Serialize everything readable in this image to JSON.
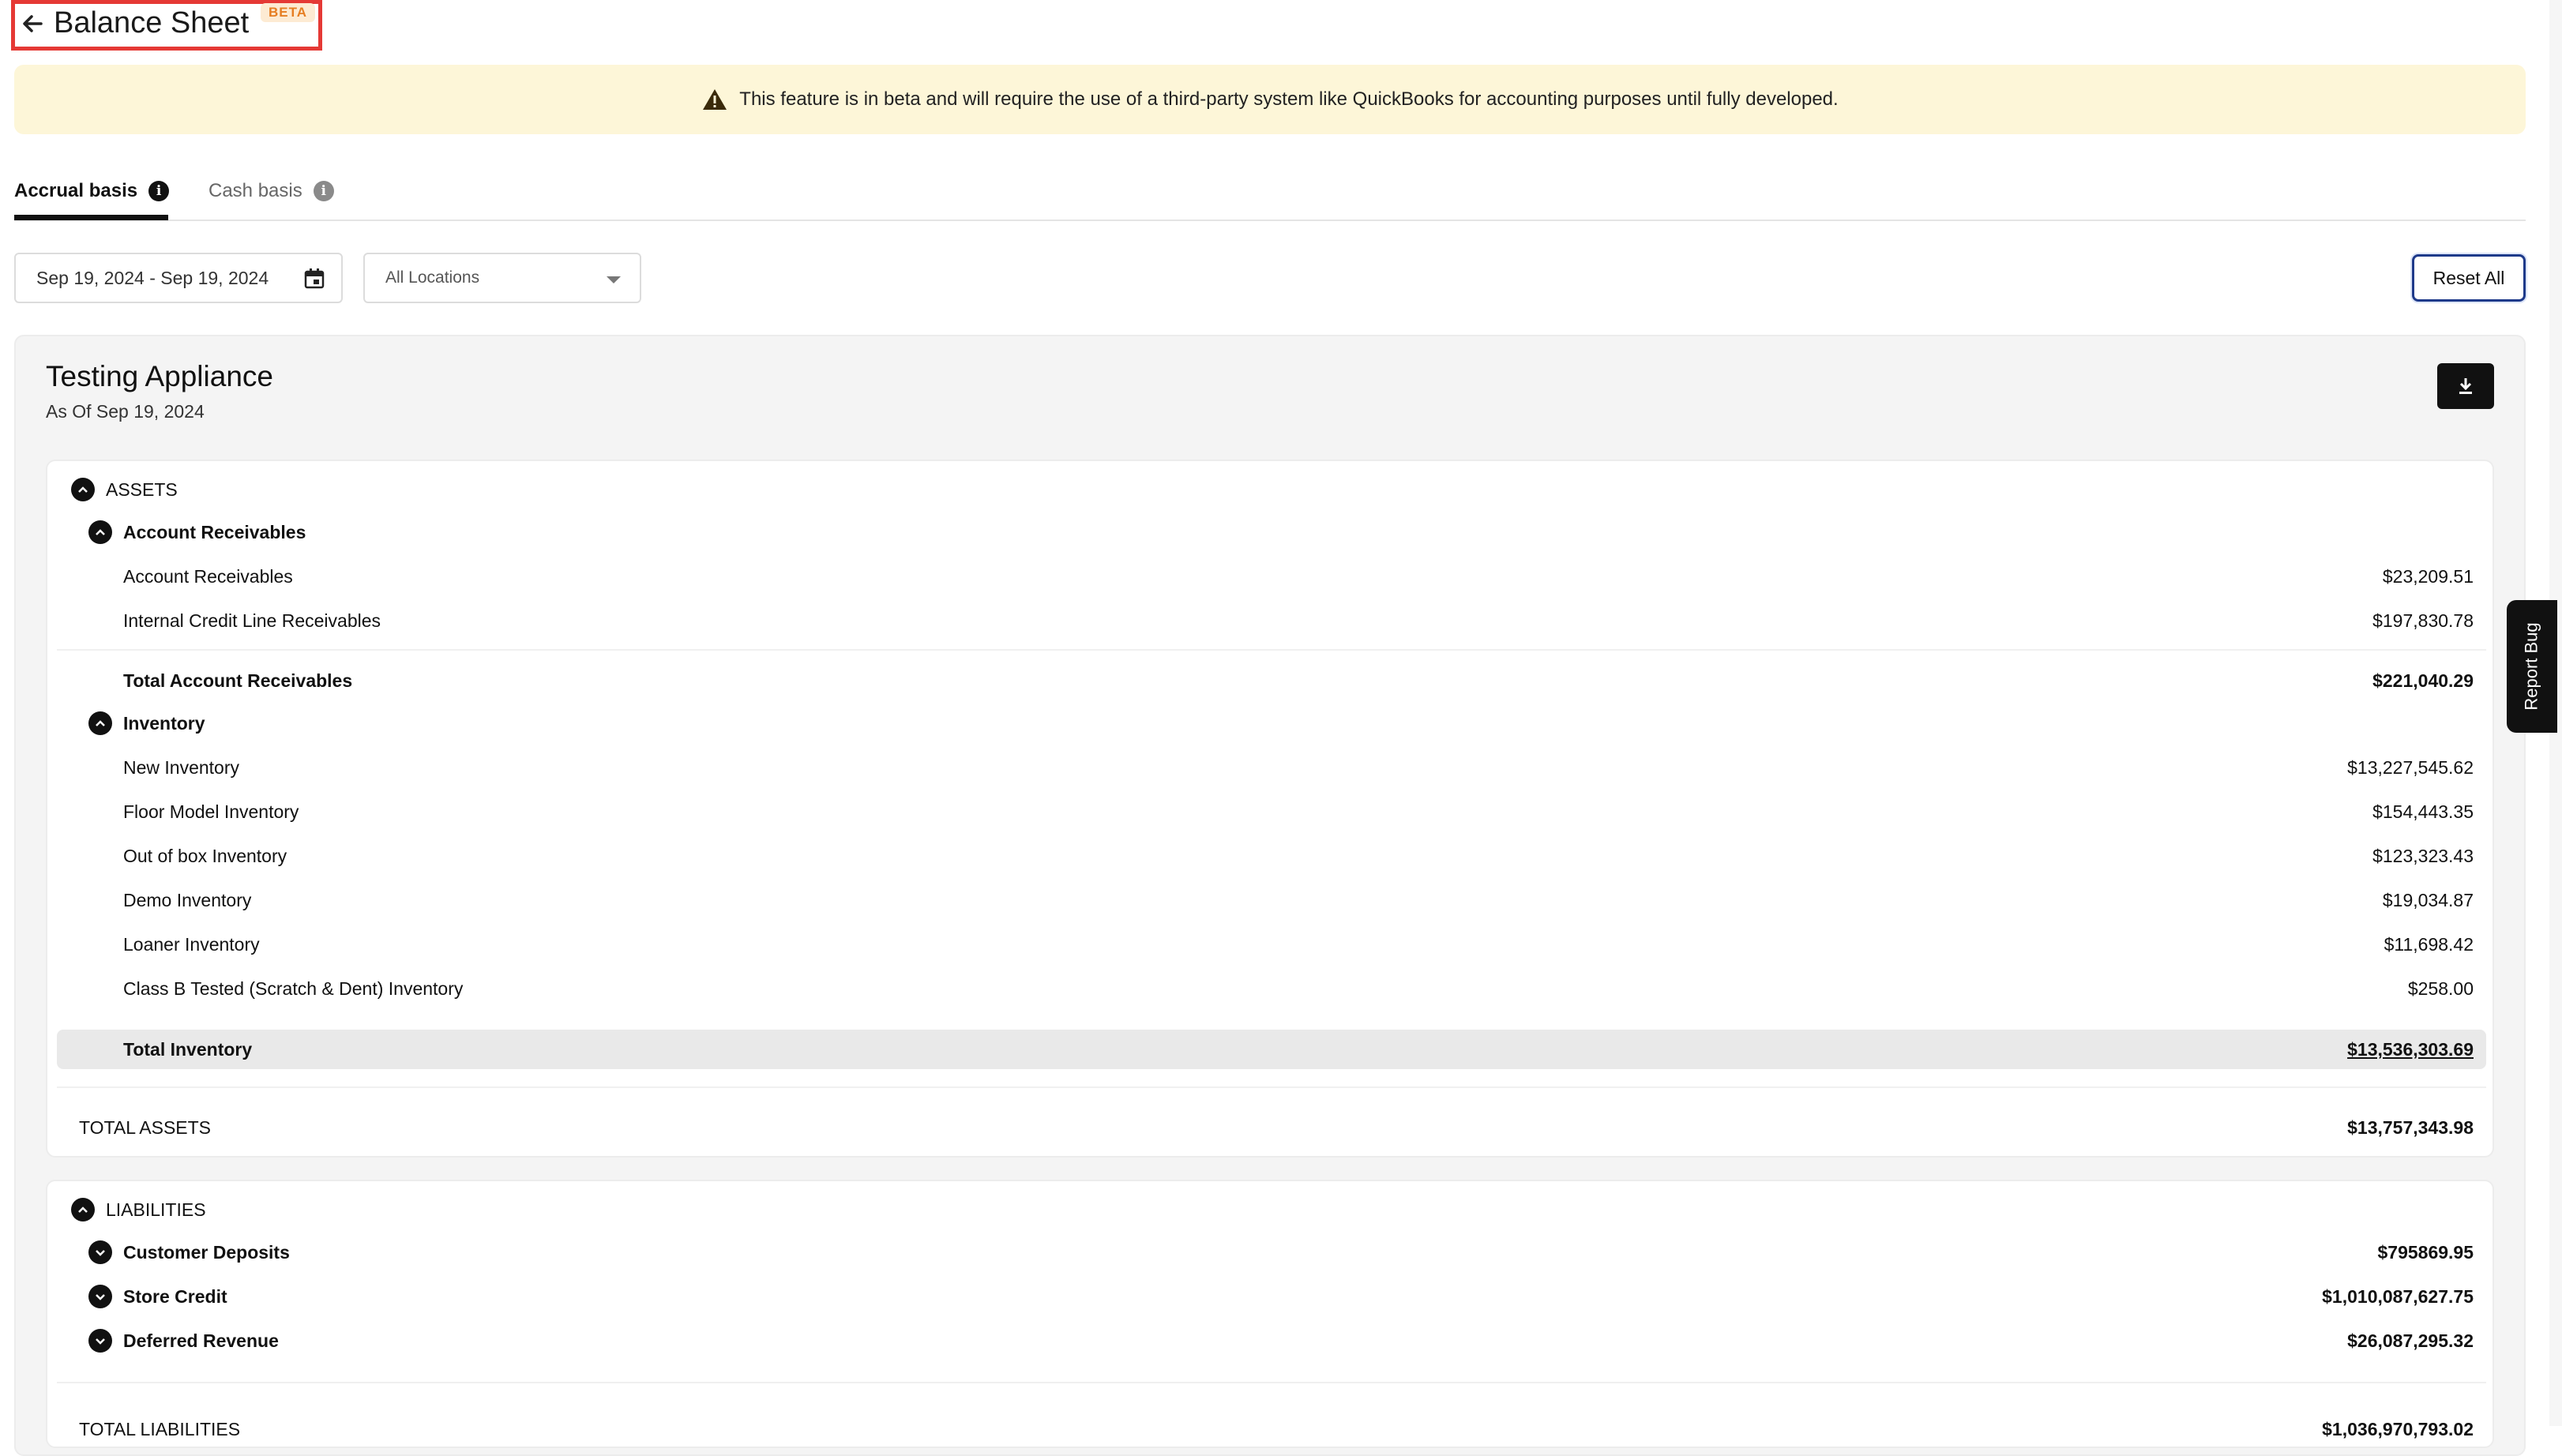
{
  "header": {
    "title": "Balance Sheet",
    "badge": "BETA"
  },
  "banner": {
    "text": "This feature is in beta and will require the use of a third-party system like QuickBooks for accounting purposes until fully developed."
  },
  "tabs": [
    {
      "label": "Accrual basis",
      "active": true
    },
    {
      "label": "Cash basis",
      "active": false
    }
  ],
  "filters": {
    "date_range": "Sep 19, 2024 - Sep 19, 2024",
    "location": "All Locations",
    "reset_label": "Reset All"
  },
  "report": {
    "company": "Testing Appliance",
    "as_of": "As Of Sep 19, 2024",
    "assets": {
      "title": "ASSETS",
      "account_receivables": {
        "title": "Account Receivables",
        "rows": [
          {
            "label": "Account Receivables",
            "amount": "$23,209.51"
          },
          {
            "label": "Internal Credit Line Receivables",
            "amount": "$197,830.78"
          }
        ],
        "total_label": "Total Account Receivables",
        "total_amount": "$221,040.29"
      },
      "inventory": {
        "title": "Inventory",
        "rows": [
          {
            "label": "New Inventory",
            "amount": "$13,227,545.62"
          },
          {
            "label": "Floor Model Inventory",
            "amount": "$154,443.35"
          },
          {
            "label": "Out of box Inventory",
            "amount": "$123,323.43"
          },
          {
            "label": "Demo Inventory",
            "amount": "$19,034.87"
          },
          {
            "label": "Loaner Inventory",
            "amount": "$11,698.42"
          },
          {
            "label": "Class B Tested (Scratch & Dent) Inventory",
            "amount": "$258.00"
          }
        ],
        "total_label": "Total Inventory",
        "total_amount": "$13,536,303.69"
      },
      "total_label": "TOTAL ASSETS",
      "total_amount": "$13,757,343.98"
    },
    "liabilities": {
      "title": "LIABILITIES",
      "rows": [
        {
          "label": "Customer Deposits",
          "amount": "$795869.95"
        },
        {
          "label": "Store Credit",
          "amount": "$1,010,087,627.75"
        },
        {
          "label": "Deferred Revenue",
          "amount": "$26,087,295.32"
        }
      ],
      "total_label": "TOTAL LIABILITIES",
      "total_amount": "$1,036,970,793.02"
    }
  },
  "report_bug_label": "Report Bug",
  "colors": {
    "beta_badge": "#e67e22",
    "banner_bg": "#fdf6d8",
    "highlight_box": "#e53935",
    "reset_border": "#1e3a8a"
  }
}
